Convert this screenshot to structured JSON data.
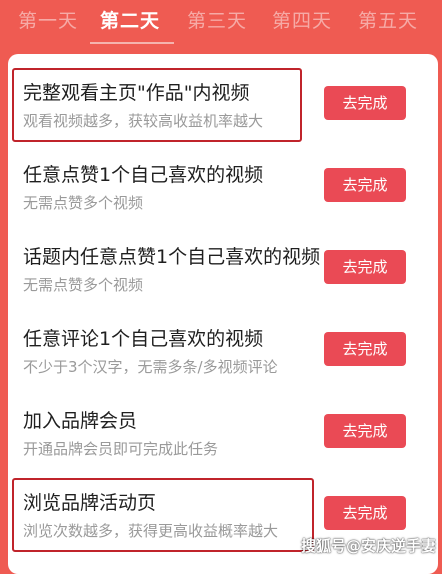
{
  "tabs": [
    {
      "label": "第一天",
      "active": false
    },
    {
      "label": "第二天",
      "active": true
    },
    {
      "label": "第三天",
      "active": false
    },
    {
      "label": "第四天",
      "active": false
    },
    {
      "label": "第五天",
      "active": false
    }
  ],
  "tasks": [
    {
      "title": "完整观看主页\"作品\"内视频",
      "desc": "观看视频越多，获较高收益机率越大",
      "button": "去完成",
      "highlighted": true
    },
    {
      "title": "任意点赞1个自己喜欢的视频",
      "desc": "无需点赞多个视频",
      "button": "去完成",
      "highlighted": false
    },
    {
      "title": "话题内任意点赞1个自己喜欢的视频",
      "desc": "无需点赞多个视频",
      "button": "去完成",
      "highlighted": false
    },
    {
      "title": "任意评论1个自己喜欢的视频",
      "desc": "不少于3个汉字，无需多条/多视频评论",
      "button": "去完成",
      "highlighted": false
    },
    {
      "title": "加入品牌会员",
      "desc": "开通品牌会员即可完成此任务",
      "button": "去完成",
      "highlighted": false
    },
    {
      "title": "浏览品牌活动页",
      "desc": "浏览次数越多，获得更高收益概率越大",
      "button": "去完成",
      "highlighted": true
    }
  ],
  "watermark": "搜狐号@安庆逆手妻",
  "colors": {
    "background": "#ef5b52",
    "button": "#ea4a55",
    "highlight_border": "#c0242b"
  }
}
